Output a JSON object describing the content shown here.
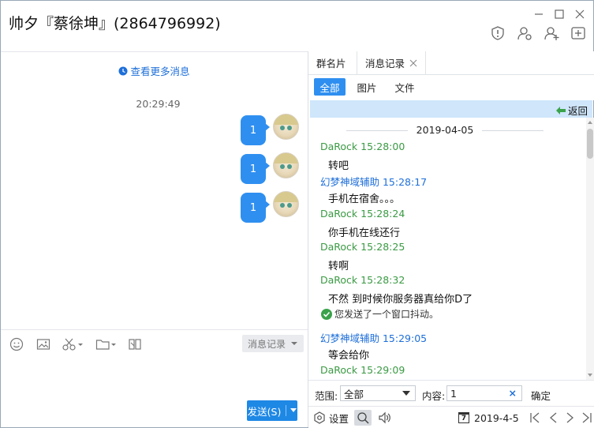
{
  "window": {
    "title": "帅夕『蔡徐坤』(2864796992)"
  },
  "left": {
    "more_messages": "查看更多消息",
    "timestamp": "20:29:49",
    "bubbles": [
      {
        "text": "1"
      },
      {
        "text": "1"
      },
      {
        "text": "1"
      }
    ],
    "history_button": "消息记录",
    "send_button": "发送(S)"
  },
  "right": {
    "tabs": [
      {
        "label": "群名片"
      },
      {
        "label": "消息记录"
      }
    ],
    "filters": [
      {
        "label": "全部"
      },
      {
        "label": "图片"
      },
      {
        "label": "文件"
      }
    ],
    "back": "返回",
    "date_header": "2019-04-05",
    "messages": [
      {
        "sender": "DaRock 15:28:00",
        "text": "转吧"
      },
      {
        "sender": "幻梦神域辅助 15:28:17",
        "text": "手机在宿舍。。。"
      },
      {
        "sender": "DaRock 15:28:24",
        "text": "你手机在线还行"
      },
      {
        "sender": "DaRock 15:28:25",
        "text": "转啊"
      },
      {
        "sender": "DaRock 15:28:32",
        "text": "不然 到时候你服务器真给你D了"
      },
      {
        "sender": "幻梦神域辅助 15:29:05",
        "text": "等会给你"
      },
      {
        "sender": "DaRock 15:29:09",
        "text": ""
      }
    ],
    "shake_notice": "您发送了一个窗口抖动。",
    "search": {
      "range_label": "范围:",
      "range_value": "全部",
      "content_label": "内容:",
      "content_value": "1",
      "confirm": "确定"
    },
    "bottom": {
      "settings": "设置",
      "date": "2019-4-5",
      "calendar_day": "7"
    }
  },
  "colors": {
    "accent": "#2f8ff0",
    "green_sender": "#3a9a43",
    "blue_sender": "#1e6fd9",
    "back_bar": "#cfe6fb"
  }
}
